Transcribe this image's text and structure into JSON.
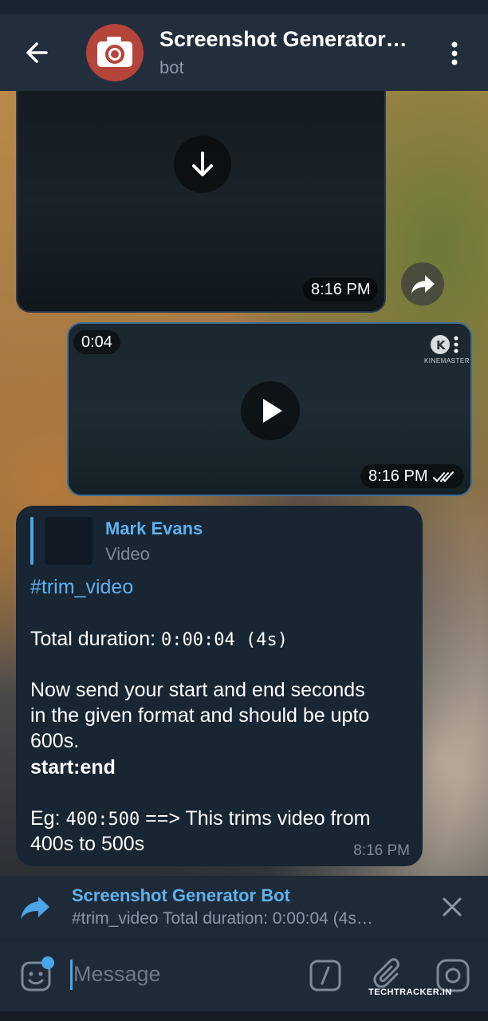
{
  "header": {
    "title": "Screenshot Generator…",
    "subtitle": "bot"
  },
  "messages": {
    "video1": {
      "time": "8:16 PM"
    },
    "video2": {
      "duration": "0:04",
      "watermark": "KINEMASTER",
      "time": "8:16 PM"
    },
    "bot_message": {
      "reply_name": "Mark Evans",
      "reply_type": "Video",
      "hashtag": "#trim_video",
      "duration_label": "Total duration:",
      "duration_value": "0:00:04 (4s)",
      "line1": "Now send your start and end seconds",
      "line2": "in the given format and should be upto",
      "line3": "600s.",
      "format": "start:end",
      "eg_label": "Eg:",
      "eg_value": "400:500",
      "eg_rest": " ==> This trims video from",
      "eg_line2": "400s to 500s",
      "time": "8:16 PM"
    }
  },
  "reply_panel": {
    "title": "Screenshot Generator Bot",
    "text": "#trim_video  Total duration: 0:00:04 (4s…"
  },
  "input": {
    "placeholder": "Message"
  },
  "watermark": "TECHTRACKER.IN",
  "colors": {
    "accent": "#4aa6e9",
    "header_bg": "#232e3c",
    "bubble_bg": "#182533",
    "avatar_bg": "#b5443a"
  }
}
